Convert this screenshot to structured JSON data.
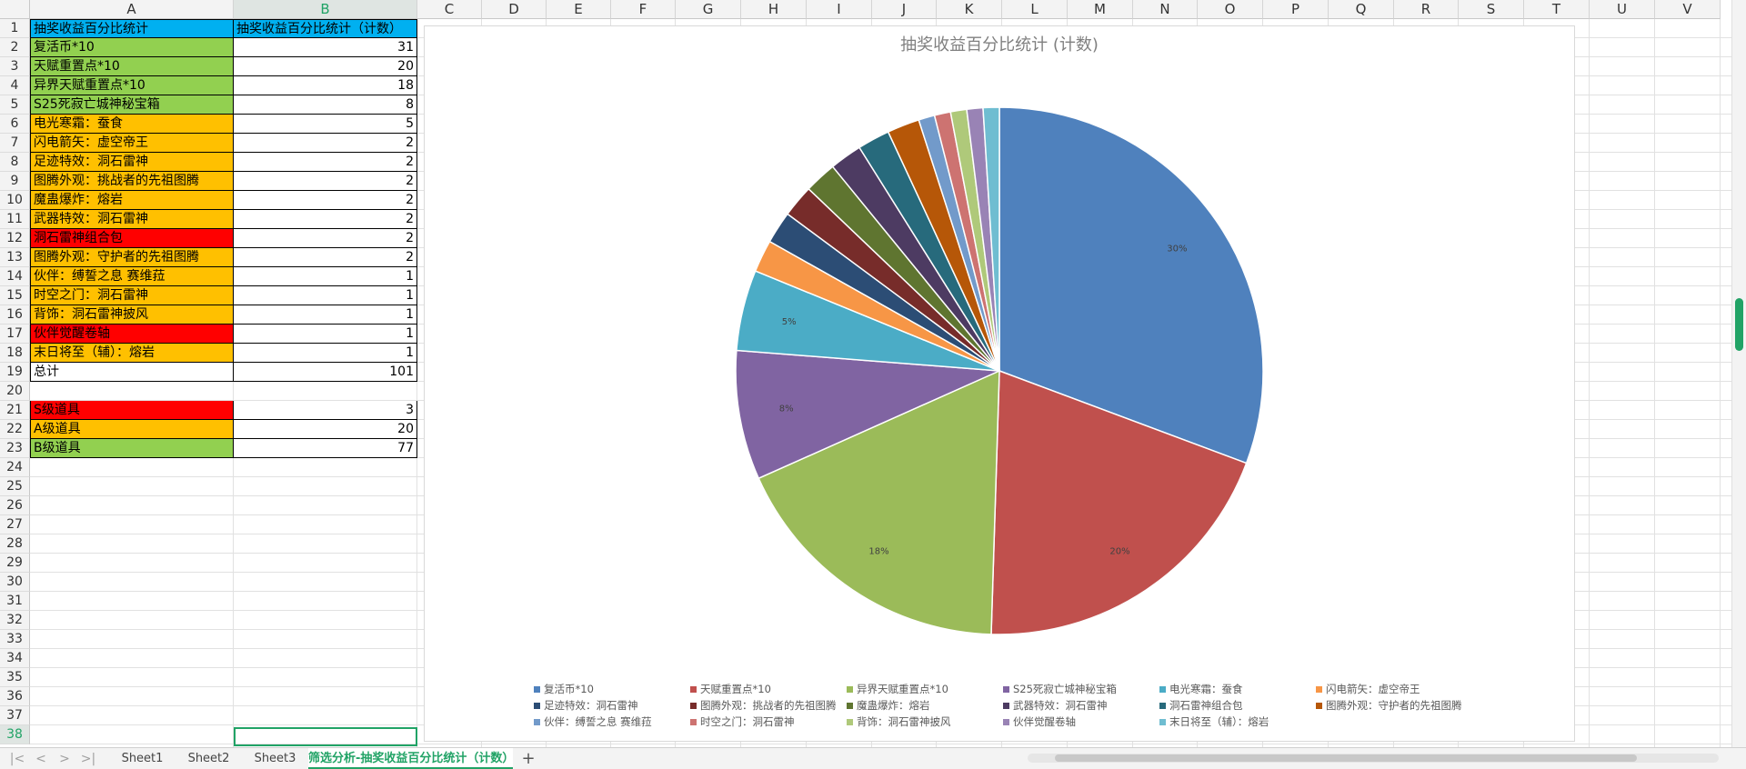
{
  "columns": [
    "A",
    "B",
    "C",
    "D",
    "E",
    "F",
    "G",
    "H",
    "I",
    "J",
    "K",
    "L",
    "M",
    "N",
    "O",
    "P",
    "Q",
    "R",
    "S",
    "T",
    "U",
    "V"
  ],
  "rows": [
    {
      "n": "1",
      "a": "抽奖收益百分比统计",
      "b": "抽奖收益百分比统计（计数）",
      "bg": "#00b0f0"
    },
    {
      "n": "2",
      "a": "复活币*10",
      "b": "31",
      "bg": "#92d050"
    },
    {
      "n": "3",
      "a": "天赋重置点*10",
      "b": "20",
      "bg": "#92d050"
    },
    {
      "n": "4",
      "a": "异界天赋重置点*10",
      "b": "18",
      "bg": "#92d050"
    },
    {
      "n": "5",
      "a": "S25死寂亡城神秘宝箱",
      "b": "8",
      "bg": "#92d050"
    },
    {
      "n": "6",
      "a": "电光寒霜：蚕食",
      "b": "5",
      "bg": "#ffc000"
    },
    {
      "n": "7",
      "a": "闪电箭矢：虚空帝王",
      "b": "2",
      "bg": "#ffc000"
    },
    {
      "n": "8",
      "a": "足迹特效：洞石雷神",
      "b": "2",
      "bg": "#ffc000"
    },
    {
      "n": "9",
      "a": "图腾外观：挑战者的先祖图腾",
      "b": "2",
      "bg": "#ffc000"
    },
    {
      "n": "10",
      "a": "魔蛊爆炸：熔岩",
      "b": "2",
      "bg": "#ffc000"
    },
    {
      "n": "11",
      "a": "武器特效：洞石雷神",
      "b": "2",
      "bg": "#ffc000"
    },
    {
      "n": "12",
      "a": "洞石雷神组合包",
      "b": "2",
      "bg": "#ff0000"
    },
    {
      "n": "13",
      "a": "图腾外观：守护者的先祖图腾",
      "b": "2",
      "bg": "#ffc000"
    },
    {
      "n": "14",
      "a": "伙伴：缚誓之息 赛维菈",
      "b": "1",
      "bg": "#ffc000"
    },
    {
      "n": "15",
      "a": "时空之门：洞石雷神",
      "b": "1",
      "bg": "#ffc000"
    },
    {
      "n": "16",
      "a": "背饰：洞石雷神披风",
      "b": "1",
      "bg": "#ffc000"
    },
    {
      "n": "17",
      "a": "伙伴觉醒卷轴",
      "b": "1",
      "bg": "#ff0000"
    },
    {
      "n": "18",
      "a": "末日将至（辅）：熔岩",
      "b": "1",
      "bg": "#ffc000"
    },
    {
      "n": "19",
      "a": "总计",
      "b": "101",
      "bg": "#ffffff"
    },
    {
      "n": "20",
      "a": "",
      "b": "",
      "bg": ""
    },
    {
      "n": "21",
      "a": "S级道具",
      "b": "3",
      "bg": "#ff0000"
    },
    {
      "n": "22",
      "a": "A级道具",
      "b": "20",
      "bg": "#ffc000"
    },
    {
      "n": "23",
      "a": "B级道具",
      "b": "77",
      "bg": "#92d050"
    },
    {
      "n": "24"
    },
    {
      "n": "25"
    },
    {
      "n": "26"
    },
    {
      "n": "27"
    },
    {
      "n": "28"
    },
    {
      "n": "29"
    },
    {
      "n": "30"
    },
    {
      "n": "31"
    },
    {
      "n": "32"
    },
    {
      "n": "33"
    },
    {
      "n": "34"
    },
    {
      "n": "35"
    },
    {
      "n": "36"
    },
    {
      "n": "37"
    },
    {
      "n": "38"
    }
  ],
  "chart_data": {
    "type": "pie",
    "title": "抽奖收益百分比统计 (计数)",
    "categories": [
      "复活币*10",
      "天赋重置点*10",
      "异界天赋重置点*10",
      "S25死寂亡城神秘宝箱",
      "电光寒霜：蚕食",
      "闪电箭矢：虚空帝王",
      "足迹特效：洞石雷神",
      "图腾外观：挑战者的先祖图腾",
      "魔蛊爆炸：熔岩",
      "武器特效：洞石雷神",
      "洞石雷神组合包",
      "图腾外观：守护者的先祖图腾",
      "伙伴：缚誓之息 赛维菈",
      "时空之门：洞石雷神",
      "背饰：洞石雷神披风",
      "伙伴觉醒卷轴",
      "末日将至（辅）：熔岩"
    ],
    "values": [
      31,
      20,
      18,
      8,
      5,
      2,
      2,
      2,
      2,
      2,
      2,
      2,
      1,
      1,
      1,
      1,
      1
    ],
    "data_labels": [
      "30%",
      "20%",
      "18%",
      "8%",
      "5%",
      "",
      "",
      "",
      "",
      "",
      "",
      "",
      "",
      "",
      "",
      "",
      ""
    ],
    "colors": [
      "#4f81bd",
      "#c0504d",
      "#9bbb59",
      "#8064a2",
      "#4bacc6",
      "#f79646",
      "#2c4d75",
      "#772c2a",
      "#5f7530",
      "#4d3b62",
      "#276a7c",
      "#b65708",
      "#729aca",
      "#cd7371",
      "#afc97a",
      "#9983b5",
      "#6fbdd1"
    ],
    "legend_position": "bottom"
  },
  "tabs": [
    "Sheet1",
    "Sheet2",
    "Sheet3",
    "筛选分析-抽奖收益百分比统计（计数）"
  ],
  "add_tab_label": "+",
  "nav": [
    "|<",
    "<",
    ">",
    ">|"
  ]
}
